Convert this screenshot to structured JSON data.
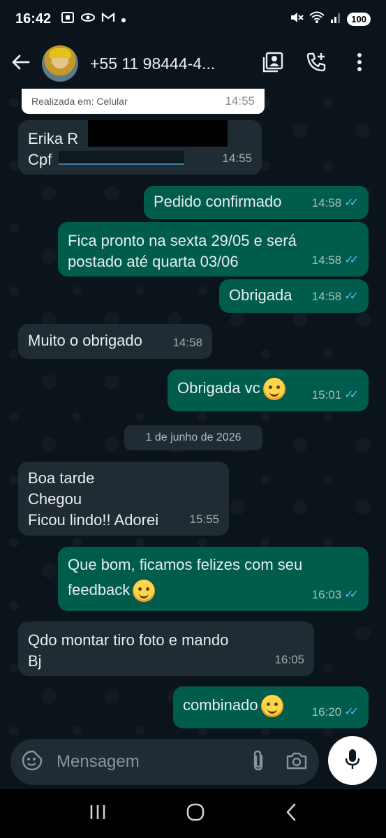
{
  "status_bar": {
    "time": "16:42",
    "battery": "100"
  },
  "header": {
    "contact_name": "+55 11 98444-4..."
  },
  "messages": [
    {
      "dir": "in",
      "text": "Erika R\nCpf",
      "time": "14:55"
    },
    {
      "dir": "out",
      "text": "Pedido confirmado",
      "time": "14:58"
    },
    {
      "dir": "out",
      "text": "Fica pronto na sexta 29/05 e será\npostado até quarta 03/06",
      "time": "14:58"
    },
    {
      "dir": "out",
      "text": "Obrigada",
      "time": "14:58"
    },
    {
      "dir": "in",
      "text": "Muito o obrigado",
      "time": "14:58"
    },
    {
      "dir": "out",
      "text": "Obrigada vc",
      "time": "15:01"
    },
    {
      "dir": "in",
      "text": "Boa  tarde\nChegou\nFicou lindo!! Adorei",
      "time": "15:55"
    },
    {
      "dir": "out",
      "text": "Que bom, ficamos felizes com seu\nfeedback",
      "time": "16:03"
    },
    {
      "dir": "in",
      "text": "Qdo montar tiro foto e mando\nBj",
      "time": "16:05"
    },
    {
      "dir": "out",
      "text": "combinado",
      "time": "16:20"
    }
  ],
  "quoted_card": {
    "label": "Realizada em:  Celular",
    "time": "14:55"
  },
  "date_separator": "1 de junho de 2026",
  "composer": {
    "placeholder": "Mensagem"
  },
  "colors": {
    "outgoing": "#005c4b",
    "incoming": "#202c33",
    "read_ticks": "#53bdeb",
    "background": "#0b141a"
  }
}
